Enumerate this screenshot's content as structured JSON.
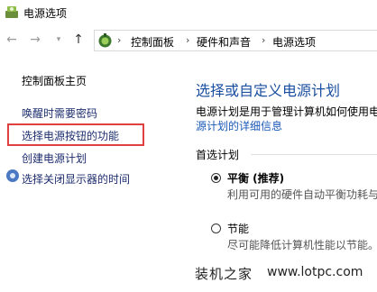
{
  "window": {
    "title": "电源选项",
    "icon": "power-options-icon"
  },
  "nav": {
    "back_icon": "arrow-left-icon",
    "forward_icon": "arrow-right-icon",
    "recent_icon": "chevron-down-icon",
    "up_icon": "arrow-up-icon"
  },
  "address": {
    "crumbs": [
      "控制面板",
      "硬件和声音",
      "电源选项"
    ],
    "separator": "›"
  },
  "sidebar": {
    "home": "控制面板主页",
    "items": [
      {
        "label": "唤醒时需要密码"
      },
      {
        "label": "选择电源按钮的功能"
      },
      {
        "label": "创建电源计划"
      },
      {
        "label": "选择关闭显示器的时间"
      }
    ]
  },
  "main": {
    "heading": "选择或自定义电源计划",
    "description": "电源计划是用于管理计算机如何使用电",
    "link": "源计划的详细信息",
    "section_label": "首选计划",
    "plans": [
      {
        "name": "平衡 (推荐)",
        "desc": "利用可用的硬件自动平衡功耗与",
        "selected": true
      },
      {
        "name": "节能",
        "desc": "尽可能降低计算机性能以节能。",
        "selected": false
      }
    ]
  },
  "watermark": {
    "text": "装机之家",
    "url": "www.lotpc.com"
  },
  "colors": {
    "highlight_border": "#e04040",
    "heading": "#1a4fa0",
    "link": "#1a59b8"
  }
}
